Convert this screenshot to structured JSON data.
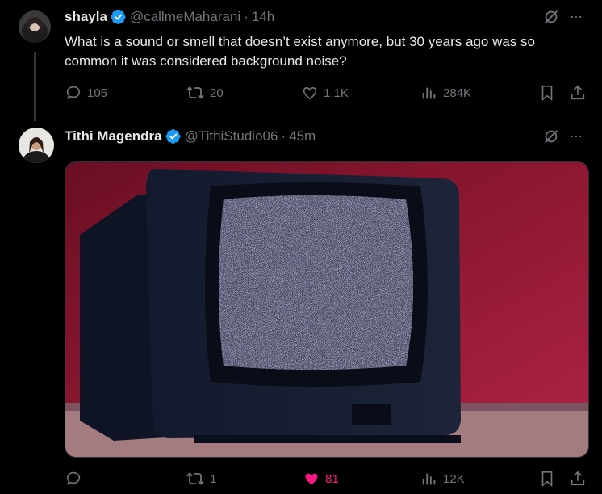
{
  "tweet1": {
    "name": "shayla",
    "handle": "@callmeMaharani",
    "dot": "·",
    "time": "14h",
    "text": "What is a sound or smell that doesn’t exist anymore, but 30 years ago was so common it was considered background noise?",
    "actions": {
      "replies": "105",
      "reposts": "20",
      "likes": "1.1K",
      "views": "284K"
    }
  },
  "tweet2": {
    "name": "Tithi Magendra",
    "handle": "@TithiStudio06",
    "dot": "·",
    "time": "45m",
    "actions": {
      "replies": "",
      "reposts": "1",
      "likes": "81",
      "views": "12K"
    }
  },
  "more_label": "···",
  "colors": {
    "accent_blue": "#1d9bf0",
    "like_pink": "#f91880",
    "muted": "#71767b"
  }
}
